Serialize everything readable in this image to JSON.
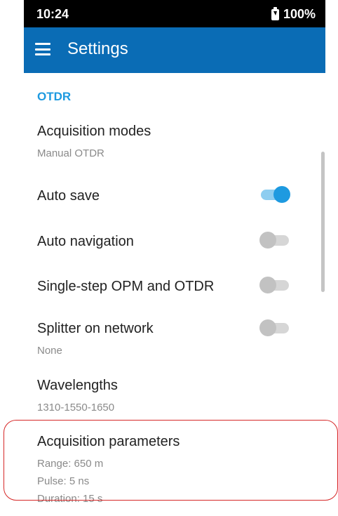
{
  "status_bar": {
    "time": "10:24",
    "battery": "100%"
  },
  "app_bar": {
    "title": "Settings",
    "menu_icon": "hamburger-menu-icon"
  },
  "section": {
    "header": "OTDR"
  },
  "settings": {
    "acquisition_modes": {
      "title": "Acquisition modes",
      "value": "Manual OTDR"
    },
    "auto_save": {
      "title": "Auto save",
      "enabled": true
    },
    "auto_navigation": {
      "title": "Auto navigation",
      "enabled": false
    },
    "single_step": {
      "title": "Single-step OPM and OTDR",
      "enabled": false
    },
    "splitter": {
      "title": "Splitter on network",
      "value": "None",
      "enabled": false
    },
    "wavelengths": {
      "title": "Wavelengths",
      "value": "1310-1550-1650"
    },
    "acquisition_parameters": {
      "title": "Acquisition parameters",
      "range": "Range: 650 m",
      "pulse": "Pulse: 5 ns",
      "duration": "Duration: 15 s"
    }
  },
  "colors": {
    "app_bar": "#0a6cb5",
    "accent": "#1e9ae0",
    "highlight": "#d62828"
  }
}
